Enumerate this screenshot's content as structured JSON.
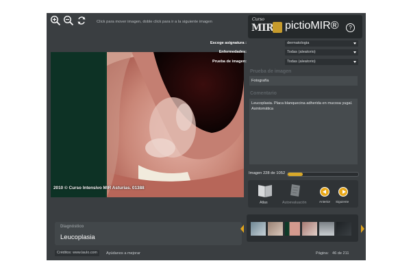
{
  "toolbar": {
    "hint": "Click para mover imagen, doble click para ir a la siguiente imagen",
    "tools": [
      "zoom-in-icon",
      "zoom-out-icon",
      "reset-icon"
    ]
  },
  "logo": {
    "curso": "Curso",
    "mir": "MIR",
    "name": "pictioMIR®",
    "help": "?"
  },
  "selectors": [
    {
      "label": "Escoge asignatura :",
      "value": "dermatologia"
    },
    {
      "label": "Enfermedades:",
      "value": "Todas (aleatorio)"
    },
    {
      "label": "Prueba de imagen:",
      "value": "Todas (aleatorio)"
    }
  ],
  "info": {
    "prueba_title": "Prueba de imagen",
    "prueba_value": "Fotografía",
    "comentario_title": "Comentario",
    "comentario_value": "Leucoplasia. Placa blanquecina adherida en mucosa yugal. Asintomática"
  },
  "image": {
    "copyright": "2010 © Curso Intensivo MIR Asturias. 01388"
  },
  "progress": {
    "label": "Imagen 228 de 1052",
    "fraction": 0.217
  },
  "actions": {
    "atlas": "Atlas",
    "autoevaluacion": "Autoevaluación",
    "anterior": "Anterior",
    "siguiente": "Siguiente"
  },
  "diagnosis": {
    "title": "Diagnóstico",
    "value": "Leucoplasia"
  },
  "footer": {
    "credits": "Créditos: www.laulo.com",
    "improve": "Ayúdanos a mejorar",
    "page_label": "Página:",
    "page_value": "46 de 211"
  },
  "colors": {
    "accent": "#e8a718",
    "panel": "#3a3e41"
  }
}
